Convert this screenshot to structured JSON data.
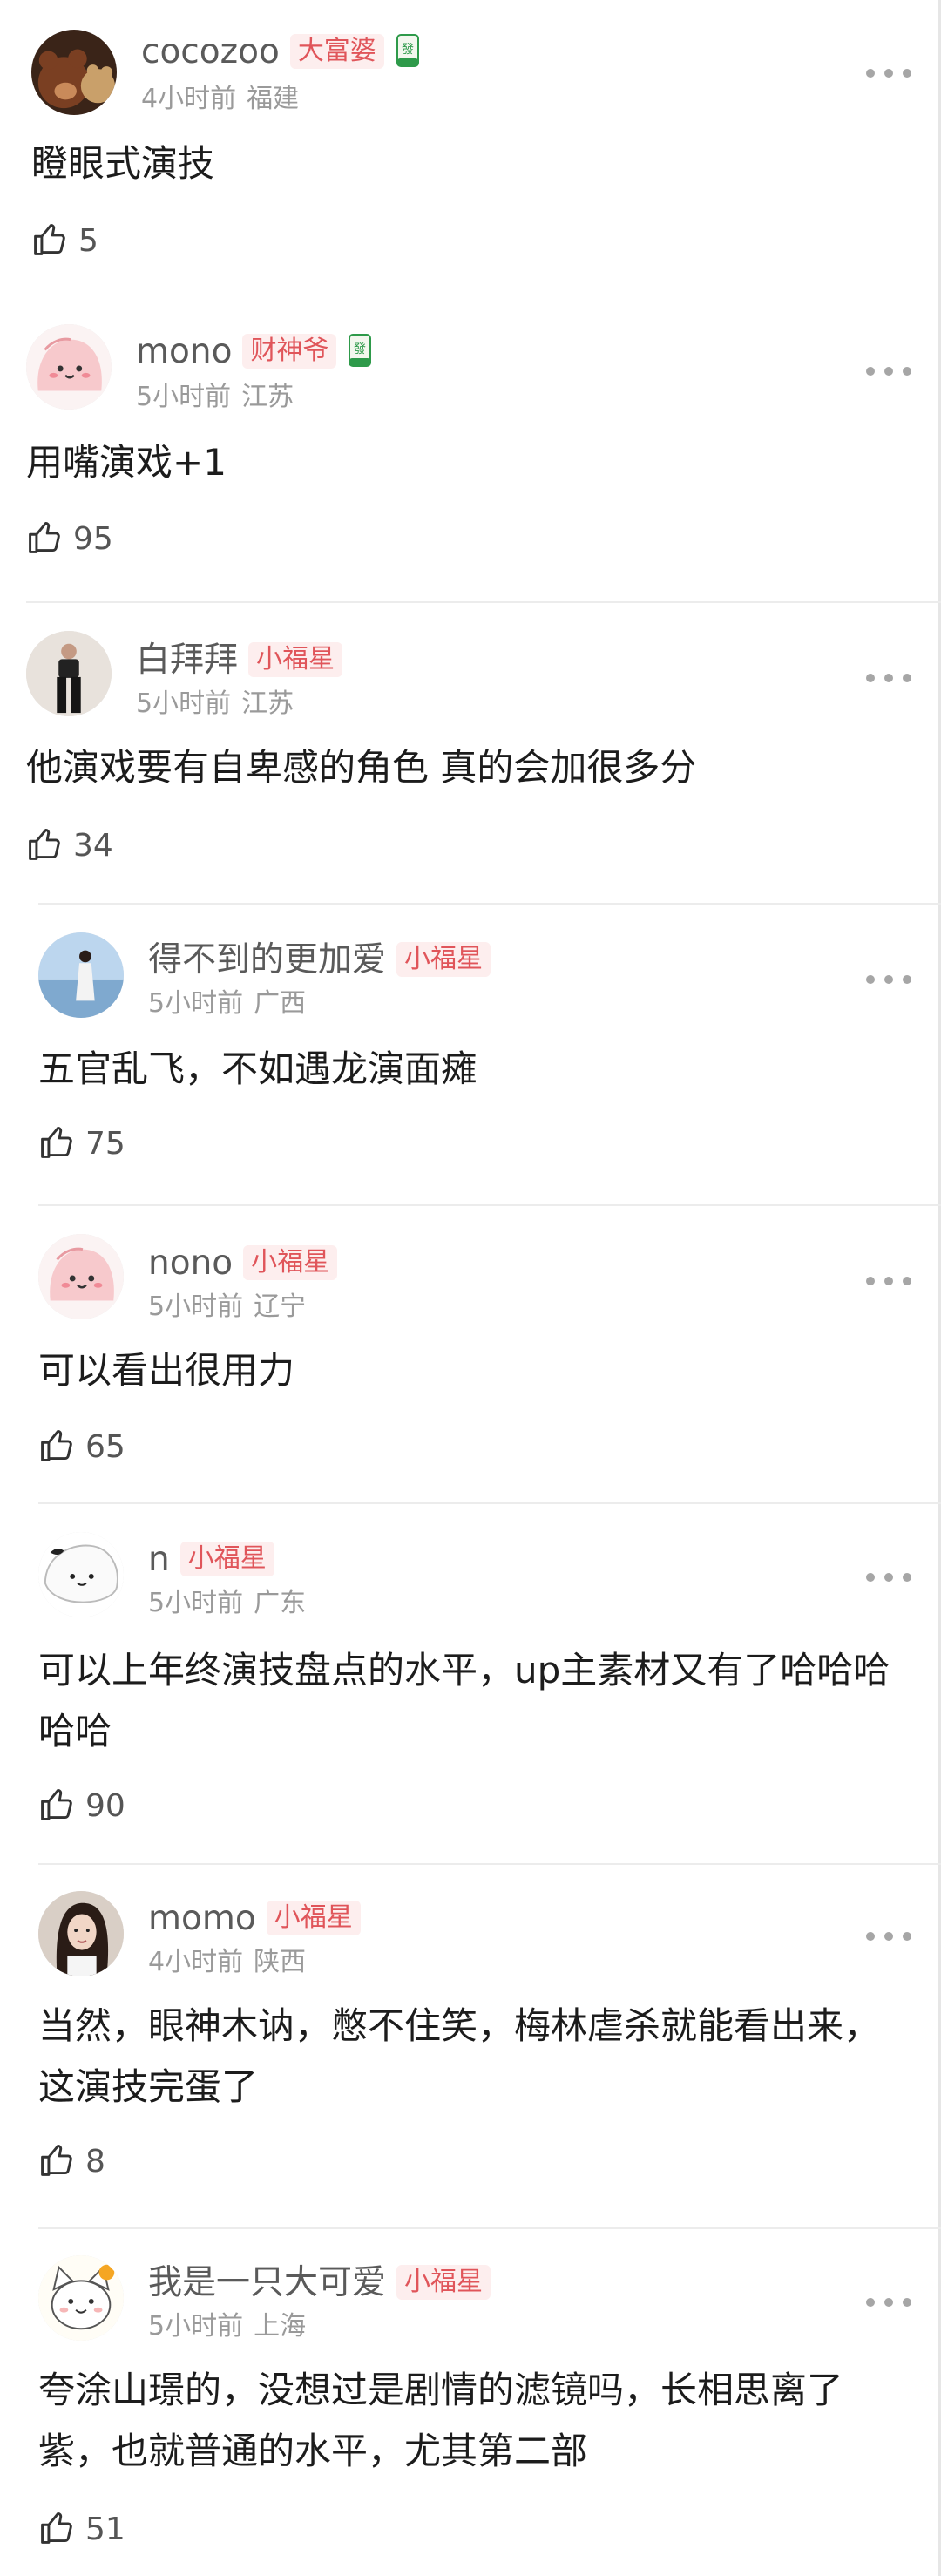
{
  "comments": [
    {
      "username": "cocozoo",
      "badge": "大富婆",
      "time": "4小时前",
      "location": "福建",
      "text": "瞪眼式演技",
      "likes": "5",
      "avatar_icon": "bear-avatar-icon"
    },
    {
      "username": "mono",
      "badge": "财神爷",
      "time": "5小时前",
      "location": "江苏",
      "text": "用嘴演戏+1",
      "likes": "95",
      "avatar_icon": "pink-blob-avatar-icon"
    },
    {
      "username": "白拜拜",
      "badge": "小福星",
      "time": "5小时前",
      "location": "江苏",
      "text": "他演戏要有自卑感的角色 真的会加很多分",
      "likes": "34",
      "avatar_icon": "person-photo-avatar-icon"
    },
    {
      "username": "得不到的更加爱",
      "badge": "小福星",
      "time": "5小时前",
      "location": "广西",
      "text": "五官乱飞，不如遇龙演面瘫",
      "likes": "75",
      "avatar_icon": "beach-photo-avatar-icon"
    },
    {
      "username": "nono",
      "badge": "小福星",
      "time": "5小时前",
      "location": "辽宁",
      "text": "可以看出很用力",
      "likes": "65",
      "avatar_icon": "pink-blob-avatar-icon"
    },
    {
      "username": "n",
      "badge": "小福星",
      "time": "5小时前",
      "location": "广东",
      "text": "可以上年终演技盘点的水平，up主素材又有了哈哈哈哈哈",
      "likes": "90",
      "avatar_icon": "white-cartoon-avatar-icon"
    },
    {
      "username": "momo",
      "badge": "小福星",
      "time": "4小时前",
      "location": "陕西",
      "text": "当然，眼神木讷，憋不住笑，梅林虐杀就能看出来，这演技完蛋了",
      "likes": "8",
      "avatar_icon": "girl-photo-avatar-icon"
    },
    {
      "username": "我是一只大可爱",
      "badge": "小福星",
      "time": "5小时前",
      "location": "上海",
      "text": "夸涂山璟的，没想过是剧情的滤镜吗，长相思离了紫，也就普通的水平，尤其第二部",
      "likes": "51",
      "avatar_icon": "cat-cartoon-avatar-icon"
    }
  ],
  "colors": {
    "badge_text": "#e0555a",
    "badge_bg": "#fdeeee",
    "username": "#5a5a5a",
    "meta": "#9a9a9a",
    "tile_green": "#2e9a4a"
  }
}
